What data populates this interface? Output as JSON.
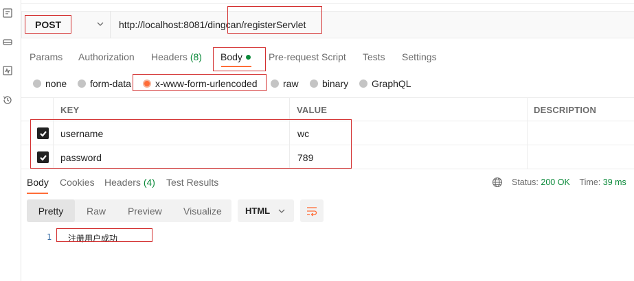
{
  "sidebar": {
    "icons": [
      "collections-icon",
      "environments-icon",
      "monitors-icon",
      "history-icon"
    ]
  },
  "request": {
    "method": "POST",
    "url": "http://localhost:8081/dingcan/registerServlet"
  },
  "request_tabs": {
    "params": "Params",
    "authorization": "Authorization",
    "headers": "Headers",
    "headers_count": "(8)",
    "body": "Body",
    "pre_request": "Pre-request Script",
    "tests": "Tests",
    "settings": "Settings"
  },
  "body_types": {
    "none": "none",
    "form_data": "form-data",
    "urlencoded": "x-www-form-urlencoded",
    "raw": "raw",
    "binary": "binary",
    "graphql": "GraphQL",
    "selected": "x-www-form-urlencoded"
  },
  "params_table": {
    "headers": {
      "key": "KEY",
      "value": "VALUE",
      "description": "DESCRIPTION"
    },
    "rows": [
      {
        "checked": true,
        "key": "username",
        "value": "wc",
        "description": ""
      },
      {
        "checked": true,
        "key": "password",
        "value": "789",
        "description": ""
      }
    ]
  },
  "response_tabs": {
    "body": "Body",
    "cookies": "Cookies",
    "headers": "Headers",
    "headers_count": "(4)",
    "test_results": "Test Results"
  },
  "response_status": {
    "status_label": "Status:",
    "status_value": "200 OK",
    "time_label": "Time:",
    "time_value": "39 ms"
  },
  "response_view": {
    "pretty": "Pretty",
    "raw": "Raw",
    "preview": "Preview",
    "visualize": "Visualize",
    "format": "HTML"
  },
  "response_body": {
    "line_number": "1",
    "text": "注册用户成功"
  },
  "colors": {
    "accent": "#ff6c37",
    "success": "#0b8a3a",
    "highlight_box": "#d32f2f"
  }
}
